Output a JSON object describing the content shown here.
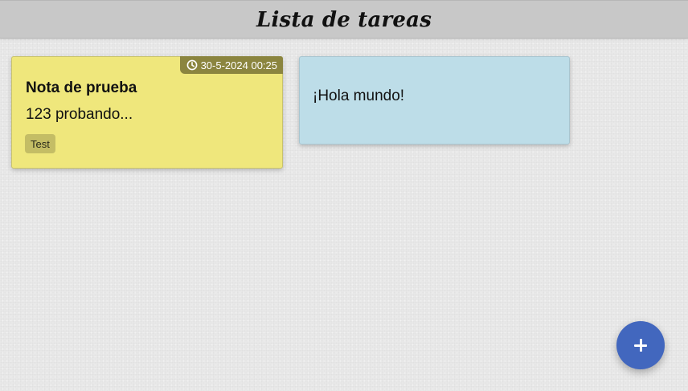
{
  "app": {
    "title": "Lista de tareas"
  },
  "notes": [
    {
      "color": "#efe77c",
      "timestamp": "30-5-2024 00:25",
      "title": "Nota de prueba",
      "body": "123 probando...",
      "tag": "Test",
      "timestamp_icon": "clock-icon"
    },
    {
      "color": "#bddde8",
      "text": "¡Hola mundo!"
    }
  ],
  "fab": {
    "icon": "plus-icon",
    "color": "#4267be"
  },
  "colors": {
    "topbar": "#c8c8c8",
    "timestamp_badge": "#8b853f",
    "background": "#e9e9e9"
  }
}
